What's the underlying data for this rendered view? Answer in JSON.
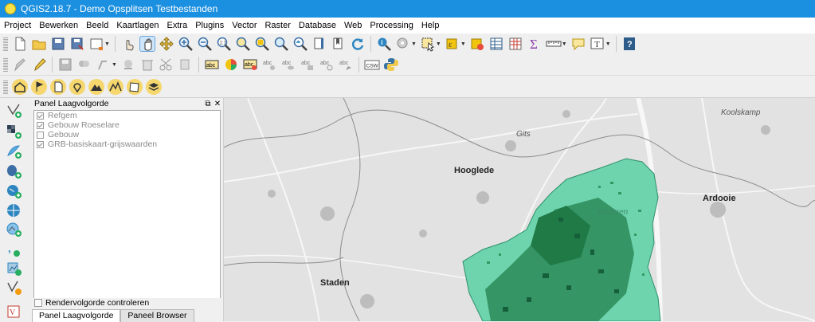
{
  "window": {
    "title": "QGIS2.18.7 - Demo Opsplitsen Testbestanden"
  },
  "menu": [
    "Project",
    "Bewerken",
    "Beeld",
    "Kaartlagen",
    "Extra",
    "Plugins",
    "Vector",
    "Raster",
    "Database",
    "Web",
    "Processing",
    "Help"
  ],
  "toolbar1_icons": [
    "new-project",
    "open-project",
    "save-project",
    "save-as",
    "print-composer",
    "touch-zoom",
    "pan",
    "pan-to-selection",
    "zoom-in",
    "zoom-out",
    "zoom-native",
    "zoom-full",
    "zoom-to-selection",
    "zoom-to-layer",
    "zoom-last",
    "zoom-next",
    "refresh",
    "identify",
    "measure",
    "select-features",
    "deselect",
    "open-attribute-table",
    "field-calculator",
    "statistics-sum",
    "measure-line",
    "map-tips",
    "text-annotation",
    "help"
  ],
  "toolbar2_icons": [
    "current-edits",
    "toggle-editing",
    "save-edits",
    "add-feature",
    "move-feature",
    "delete-selected",
    "cut-features",
    "layer-labeling",
    "layer-diagram",
    "highlight-pinned-labels",
    "pin-labels",
    "show-hide-labels",
    "move-label",
    "rotate-label",
    "change-label",
    "csw",
    "python-console"
  ],
  "toolbar3_icons": [
    "home",
    "flag",
    "document",
    "placemark",
    "mountain-route",
    "elevation",
    "map-sheet",
    "layers"
  ],
  "leftbar_icons": [
    "add-vector-layer",
    "add-raster-layer",
    "add-spatialite-layer",
    "add-postgis-layer",
    "add-wms-layer",
    "add-wcs-layer",
    "add-wfs-layer",
    "add-delimited-text",
    "new-shapefile",
    "new-temporary-layer"
  ],
  "panel": {
    "title": "Panel Laagvolgorde",
    "layers": [
      {
        "name": "Refgem",
        "checked": true
      },
      {
        "name": "Gebouw Roeselare",
        "checked": true
      },
      {
        "name": "Gebouw",
        "checked": false
      },
      {
        "name": "GRB-basiskaart-grijswaarden",
        "checked": true
      }
    ],
    "render_order_label": "Rendervolgorde controleren",
    "tabs": [
      "Panel Laagvolgorde",
      "Paneel Browser"
    ]
  },
  "map": {
    "places": [
      {
        "name": "Koolskamp",
        "style": "italic"
      },
      {
        "name": "Gits",
        "style": "italic"
      },
      {
        "name": "Hooglede",
        "style": "bold"
      },
      {
        "name": "Ardooie",
        "style": "bold"
      },
      {
        "name": "Beveren",
        "style": "italic"
      },
      {
        "name": "Staden",
        "style": "bold"
      }
    ],
    "colors": {
      "background": "#e1e1e1",
      "municipality_fill": "#6dd4ae",
      "buildings": "#1f7a45",
      "roads": "#ffffff"
    }
  }
}
